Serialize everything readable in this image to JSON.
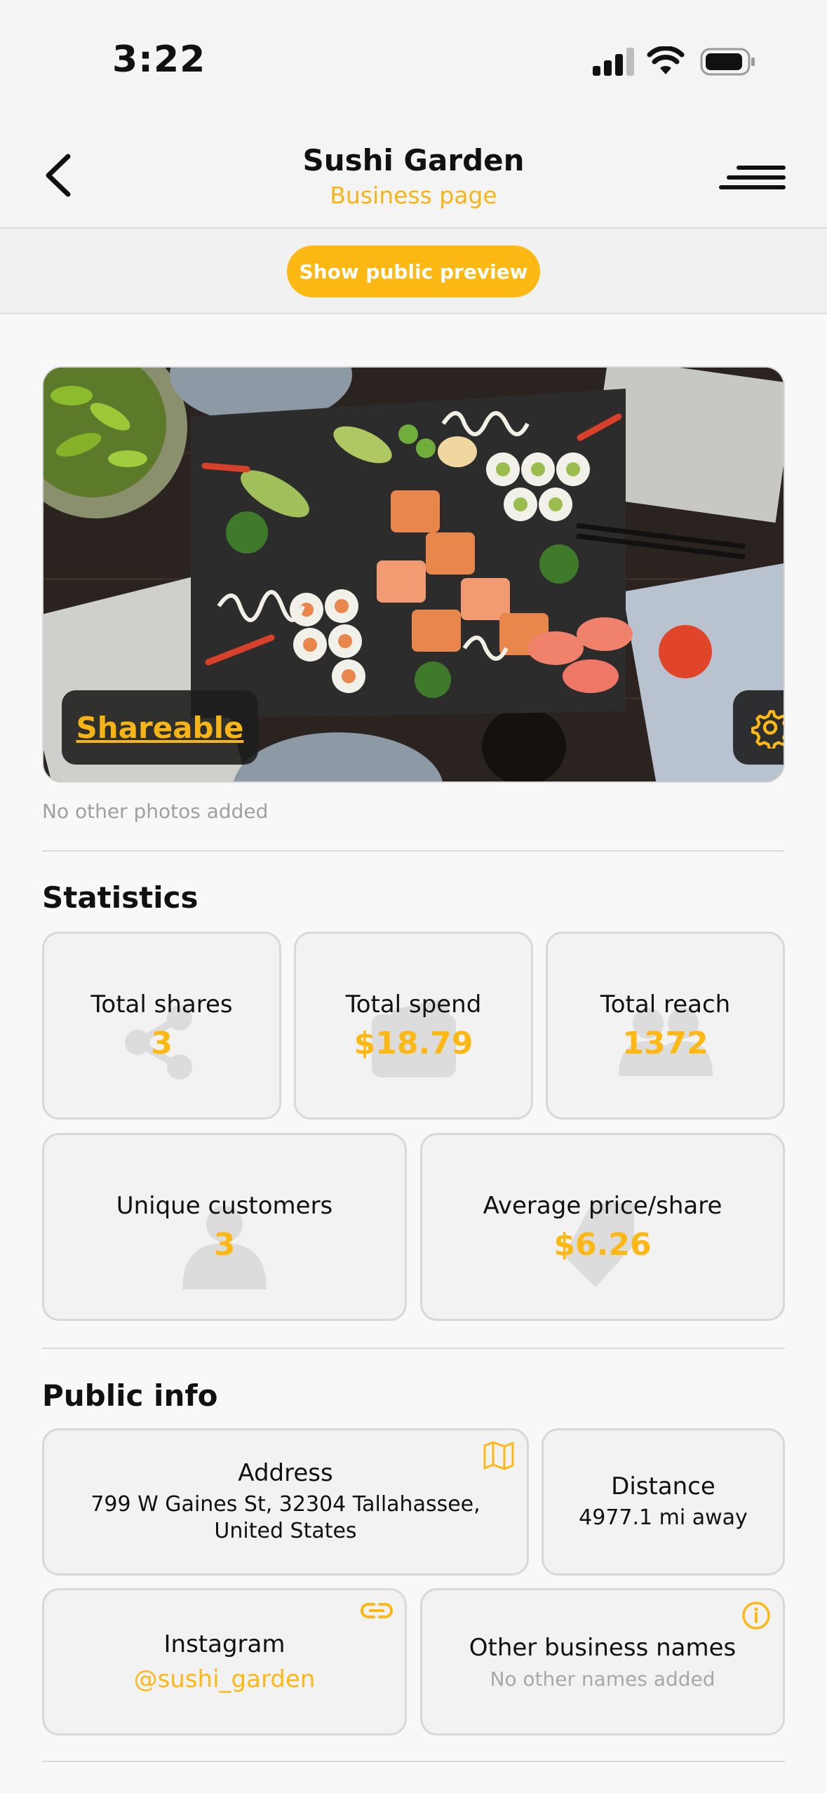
{
  "status": {
    "time": "3:22"
  },
  "header": {
    "title": "Sushi Garden",
    "subtitle": "Business page"
  },
  "preview": {
    "button_label": "Show public preview"
  },
  "hero": {
    "badge_label": "Shareable",
    "photos_note": "No other photos added"
  },
  "statistics": {
    "title": "Statistics",
    "total_shares": {
      "label": "Total shares",
      "value": "3"
    },
    "total_spend": {
      "label": "Total spend",
      "value": "$18.79"
    },
    "total_reach": {
      "label": "Total reach",
      "value": "1372"
    },
    "unique_customers": {
      "label": "Unique customers",
      "value": "3"
    },
    "avg_price": {
      "label": "Average price/share",
      "value": "$6.26"
    }
  },
  "public_info": {
    "title": "Public info",
    "address": {
      "label": "Address",
      "line1": "799 W Gaines St, 32304 Tallahassee,",
      "line2": "United States"
    },
    "distance": {
      "label": "Distance",
      "value": "4977.1 mi away"
    },
    "instagram": {
      "label": "Instagram",
      "handle": "@sushi_garden"
    },
    "other_names": {
      "label": "Other business names",
      "value": "No other names added"
    }
  },
  "colors": {
    "accent": "#fdb813",
    "text": "#111111",
    "muted": "#a0a0a0",
    "card_bg": "#f2f2f2"
  }
}
